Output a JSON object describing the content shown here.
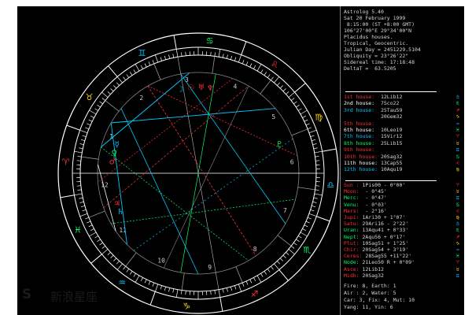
{
  "header_lines": [
    "Astrolog 5.40",
    "Sat 20 February 1999",
    " 8:15:00 (ST +8:00 GMT)",
    "106°27'00\"E 29°34'00\"N",
    "Placidus houses.",
    "Tropical, Geocentric.",
    "Julian Day = 2451229.5104",
    "Obliquity = 23°26'22\"",
    "Sidereal time: 17:18:48",
    "DeltaT =  63.5205"
  ],
  "houses": [
    {
      "label": "1st house:",
      "value": "12Lib12",
      "color": "#ff3030"
    },
    {
      "label": "2nd house:",
      "value": "7Sco22",
      "color": "#ffffff"
    },
    {
      "label": "3rd house:",
      "value": "25Tau59",
      "color": "#00c8ff"
    },
    {
      "label": "",
      "value": "20Gem32",
      "color": "#00c8ff"
    },
    {
      "label": "5th house:",
      "value": "",
      "color": "#ff3030"
    },
    {
      "label": "6th house:",
      "value": "10Leo19",
      "color": "#ffffff"
    },
    {
      "label": "7th house:",
      "value": "15Vir12",
      "color": "#00c8ff"
    },
    {
      "label": "8th house:",
      "value": "25Lib15",
      "color": "#00ff66"
    },
    {
      "label": "9th house:",
      "value": "",
      "color": "#ff3030"
    },
    {
      "label": "10th house:",
      "value": "20Sag32",
      "color": "#ff3030"
    },
    {
      "label": "11th house:",
      "value": "13Cap55",
      "color": "#ffffff"
    },
    {
      "label": "12th house:",
      "value": "10Aqu19",
      "color": "#00c8ff"
    }
  ],
  "planets": [
    {
      "label": "Sun :",
      "value": "1Pis00",
      "speed": "- 0°00'",
      "color": "#ff3030"
    },
    {
      "label": "Moon:",
      "value": "",
      "speed": "- 0°45'",
      "color": "#ff3030"
    },
    {
      "label": "Merc:",
      "value": "",
      "speed": "- 0°47'",
      "color": "#00ff66"
    },
    {
      "label": "Venu:",
      "value": "",
      "speed": "- 0°03'",
      "color": "#00ff66"
    },
    {
      "label": "Mars:",
      "value": "",
      "speed": "- 2°16'",
      "color": "#ff3030"
    },
    {
      "label": "Jupi:",
      "value": "1Ari30",
      "speed": "+ 1°07'",
      "color": "#ff3030"
    },
    {
      "label": "Satu:",
      "value": "29Ari16",
      "speed": "- 2°22'",
      "color": "#ff3030"
    },
    {
      "label": "Uran:",
      "value": "13Aqu41",
      "speed": "+ 0°33'",
      "color": "#00ff66"
    },
    {
      "label": "Nept:",
      "value": "2Aqu56",
      "speed": "+ 0°17'",
      "color": "#00ff66"
    },
    {
      "label": "Plut:",
      "value": "10Sag51",
      "speed": "+ 1°25'",
      "color": "#ff3030"
    },
    {
      "label": "Chir:",
      "value": "20Sag54",
      "speed": "+ 3°19'",
      "color": "#ff3030"
    },
    {
      "label": "Ceres:",
      "value": "28Sag55",
      "speed": "+11°22'",
      "color": "#ff3030"
    },
    {
      "label": "Node:",
      "value": "21Leo50",
      "speed": "R + 0°09'",
      "color": "#00ff66"
    },
    {
      "label": "Asce:",
      "value": "12Lib12",
      "speed": "",
      "color": "#ff3030"
    },
    {
      "label": "Midh:",
      "value": "20Sag32",
      "speed": "",
      "color": "#ff3030"
    }
  ],
  "elements_lines": [
    "Fire: 8, Earth: 1",
    "Air : 2, Water: 5",
    "Car: 3, Fix: 4, Mut: 10",
    "Yang: 11, Yin: 6"
  ],
  "house_numbers": [
    "1",
    "2",
    "3",
    "4",
    "5",
    "6",
    "7",
    "8",
    "9",
    "10",
    "11",
    "12"
  ],
  "watermark": {
    "mark": "S",
    "brand": "新浪星座"
  },
  "colors": {
    "bg": "#000000",
    "ring": "#ffffff",
    "fire": "#ff3030",
    "earth": "#ffd700",
    "air": "#00c8ff",
    "water": "#00ff66"
  },
  "zodiac_signs": [
    {
      "glyph": "♈",
      "color": "#ff3030"
    },
    {
      "glyph": "♉",
      "color": "#ffd700"
    },
    {
      "glyph": "♊",
      "color": "#00c8ff"
    },
    {
      "glyph": "♋",
      "color": "#00ff66"
    },
    {
      "glyph": "♌",
      "color": "#ff3030"
    },
    {
      "glyph": "♍",
      "color": "#ffd700"
    },
    {
      "glyph": "♎",
      "color": "#00c8ff"
    },
    {
      "glyph": "♏",
      "color": "#00ff66"
    },
    {
      "glyph": "♐",
      "color": "#ff3030"
    },
    {
      "glyph": "♑",
      "color": "#ffd700"
    },
    {
      "glyph": "♒",
      "color": "#00c8ff"
    },
    {
      "glyph": "♓",
      "color": "#00ff66"
    }
  ],
  "planet_glyphs": [
    {
      "glyph": "☉",
      "color": "#ff3030"
    },
    {
      "glyph": "☽",
      "color": "#00c8ff"
    },
    {
      "glyph": "☿",
      "color": "#00c8ff"
    },
    {
      "glyph": "♀",
      "color": "#00ff66"
    },
    {
      "glyph": "♂",
      "color": "#ff3030"
    },
    {
      "glyph": "♃",
      "color": "#ff3030"
    },
    {
      "glyph": "♄",
      "color": "#00c8ff"
    },
    {
      "glyph": "♅",
      "color": "#ff3030"
    },
    {
      "glyph": "♆",
      "color": "#ff3030"
    },
    {
      "glyph": "♇",
      "color": "#00ff66"
    }
  ]
}
